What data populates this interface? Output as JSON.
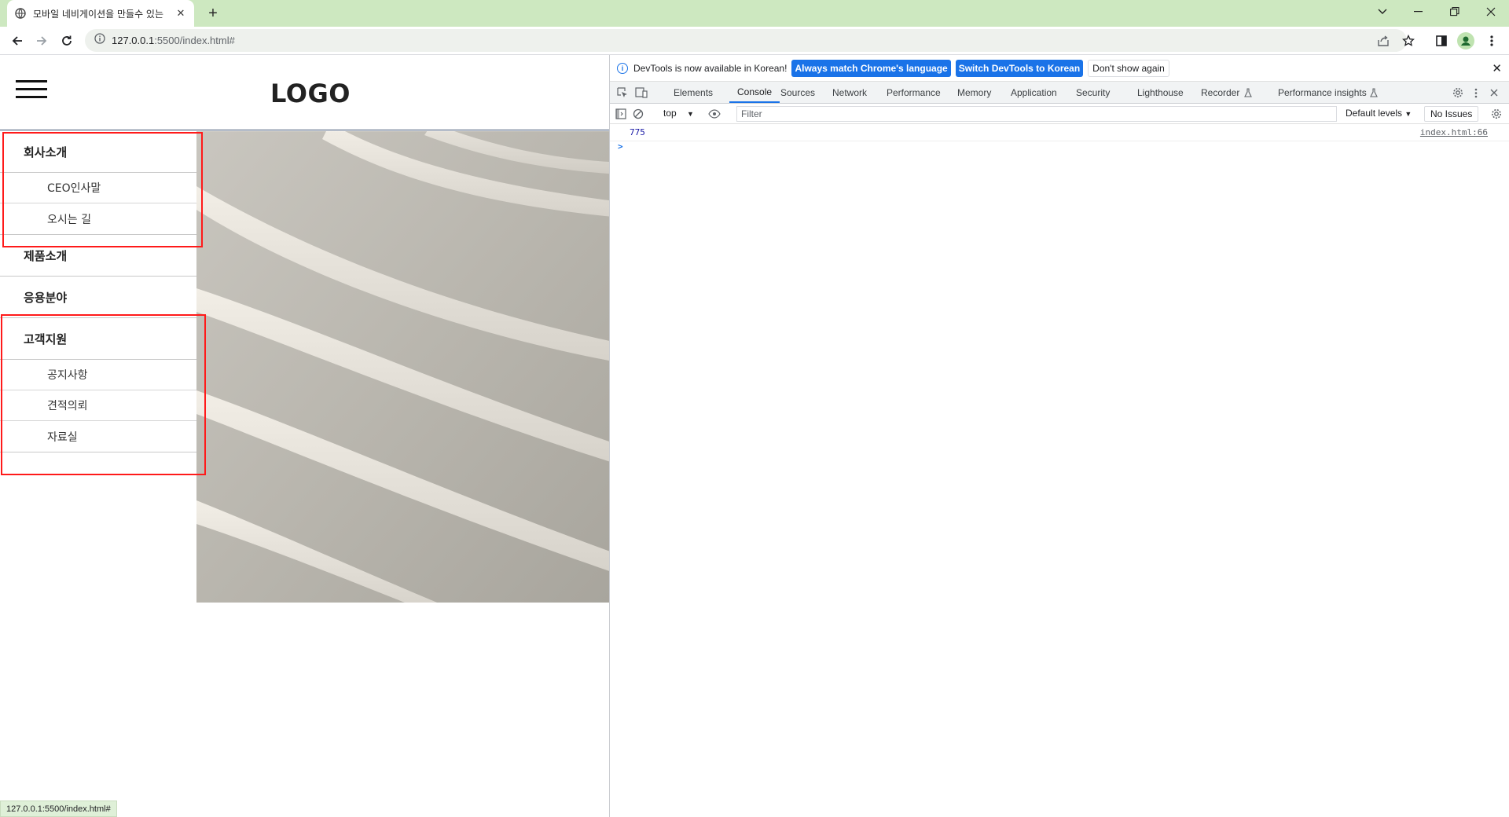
{
  "browser": {
    "tab_title": "모바일 네비게이션을 만들수 있는",
    "url_host": "127.0.0.1",
    "url_path": ":5500/index.html#",
    "status_url": "127.0.0.1:5500/index.html#"
  },
  "site": {
    "logo": "LOGO",
    "menu": [
      {
        "label": "회사소개",
        "sub": [
          "CEO인사말",
          "오시는 길"
        ]
      },
      {
        "label": "제품소개",
        "sub": []
      },
      {
        "label": "응용분야",
        "sub": []
      },
      {
        "label": "고객지원",
        "sub": [
          "공지사항",
          "견적의뢰",
          "자료실"
        ]
      }
    ]
  },
  "devtools": {
    "info_text": "DevTools is now available in Korean!",
    "btn_match": "Always match Chrome's language",
    "btn_switch": "Switch DevTools to Korean",
    "btn_dismiss": "Don't show again",
    "tabs": [
      "Elements",
      "Console",
      "Sources",
      "Network",
      "Performance",
      "Memory",
      "Application",
      "Security",
      "Lighthouse",
      "Recorder",
      "Performance insights"
    ],
    "active_tab": "Console",
    "context": "top",
    "filter_placeholder": "Filter",
    "levels": "Default levels",
    "issues": "No Issues",
    "log": {
      "value": "775",
      "source": "index.html:66"
    },
    "prompt": ">"
  }
}
